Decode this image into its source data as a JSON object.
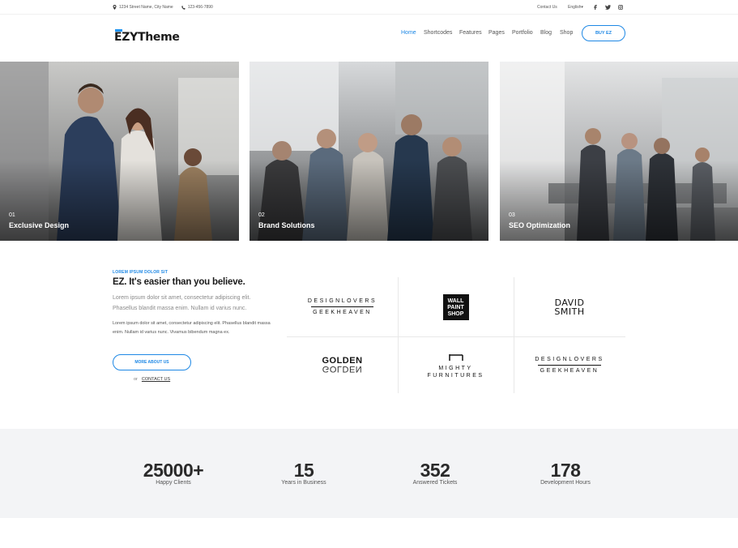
{
  "topbar": {
    "address": "1234 Street Name, City Name",
    "phone": "123-456-7890",
    "contact_link": "Contact Us",
    "language": "English",
    "social_icons": [
      "facebook-icon",
      "twitter-icon",
      "instagram-icon"
    ]
  },
  "header": {
    "logo_text": "EZYTheme",
    "nav": [
      "Home",
      "Shortcodes",
      "Features",
      "Pages",
      "Portfolio",
      "Blog",
      "Shop"
    ],
    "active_nav": "Home",
    "buy_button": "BUY EZ"
  },
  "features": [
    {
      "number": "01",
      "title": "Exclusive Design"
    },
    {
      "number": "02",
      "title": "Brand Solutions"
    },
    {
      "number": "03",
      "title": "SEO Optimization"
    }
  ],
  "about": {
    "eyebrow": "LOREM IPSUM DOLOR SIT",
    "heading": "EZ. It's easier than you believe.",
    "lead": "Lorem ipsum dolor sit amet, consectetur adipiscing elit. Phasellus blandit massa enim. Nullam id varius nunc.",
    "body": "Lorem ipsum dolor sit amet, consectetur adipiscing elit. Phasellus blandit massa enim. Nullam id varius nunc. Vivamus bibendum magna ex.",
    "more_button": "MORE ABOUT US",
    "or_text": "or",
    "contact_link": "CONTACT US"
  },
  "client_logos": {
    "designlovers_top": "DESIGNLOVERS",
    "designlovers_bottom": "GEEKHEAVEN",
    "wallpaint": [
      "WALL",
      "PAINT",
      "SHOP"
    ],
    "david": "DAVID",
    "smith": "SMITH",
    "golden": "GOLDEN",
    "mighty": "MIGHTY",
    "furnitures": "FURNITURES"
  },
  "stats": [
    {
      "number": "25000+",
      "label": "Happy Clients"
    },
    {
      "number": "15",
      "label": "Years in Business"
    },
    {
      "number": "352",
      "label": "Answered Tickets"
    },
    {
      "number": "178",
      "label": "Development Hours"
    }
  ],
  "colors": {
    "accent": "#1e88e5",
    "stats_bg": "#f3f4f6"
  }
}
